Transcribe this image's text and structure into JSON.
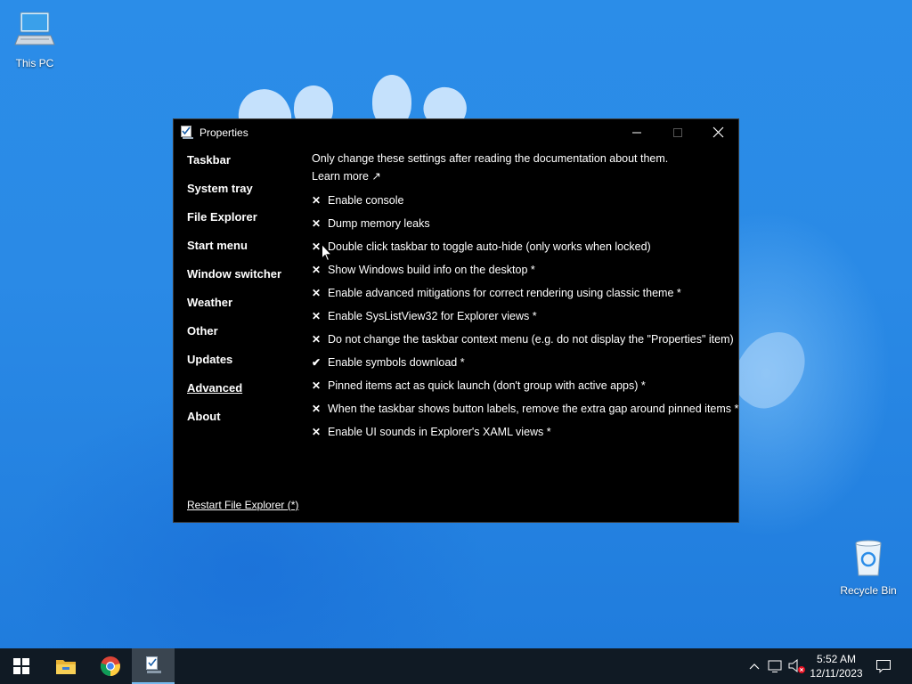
{
  "desktop": {
    "icons": [
      {
        "label": "This PC"
      },
      {
        "label": "Recycle Bin"
      }
    ]
  },
  "window": {
    "title": "Properties",
    "nav": [
      {
        "label": "Taskbar"
      },
      {
        "label": "System tray"
      },
      {
        "label": "File Explorer"
      },
      {
        "label": "Start menu"
      },
      {
        "label": "Window switcher"
      },
      {
        "label": "Weather"
      },
      {
        "label": "Other"
      },
      {
        "label": "Updates"
      },
      {
        "label": "Advanced",
        "active": true
      },
      {
        "label": "About"
      }
    ],
    "description": "Only change these settings after reading the documentation about them.",
    "learn_more": "Learn more ↗",
    "options": [
      {
        "mark": "✕",
        "label": "Enable console"
      },
      {
        "mark": "✕",
        "label": "Dump memory leaks"
      },
      {
        "mark": "✕",
        "label": "Double click taskbar to toggle auto-hide (only works when locked)"
      },
      {
        "mark": "✕",
        "label": "Show Windows build info on the desktop *"
      },
      {
        "mark": "✕",
        "label": "Enable advanced mitigations for correct rendering using classic theme *"
      },
      {
        "mark": "✕",
        "label": "Enable SysListView32 for Explorer views *"
      },
      {
        "mark": "✕",
        "label": "Do not change the taskbar context menu (e.g. do not display the \"Properties\" item)"
      },
      {
        "mark": "✔",
        "label": "Enable symbols download *"
      },
      {
        "mark": "✕",
        "label": "Pinned items act as quick launch (don't group with active apps) *"
      },
      {
        "mark": "✕",
        "label": "When the taskbar shows button labels, remove the extra gap around pinned items *"
      },
      {
        "mark": "✕",
        "label": "Enable UI sounds in Explorer's XAML views *"
      }
    ],
    "restart_link": "Restart File Explorer (*)"
  },
  "taskbar": {
    "apps": [
      {
        "icon": "start-icon"
      },
      {
        "icon": "file-explorer-icon"
      },
      {
        "icon": "chrome-icon"
      },
      {
        "icon": "properties-app-icon",
        "active": true
      }
    ],
    "tray_icons": [
      "chevron-up-icon",
      "network-icon",
      "volume-muted-icon",
      "notification-icon"
    ],
    "time": "5:52 AM",
    "date": "12/11/2023"
  }
}
